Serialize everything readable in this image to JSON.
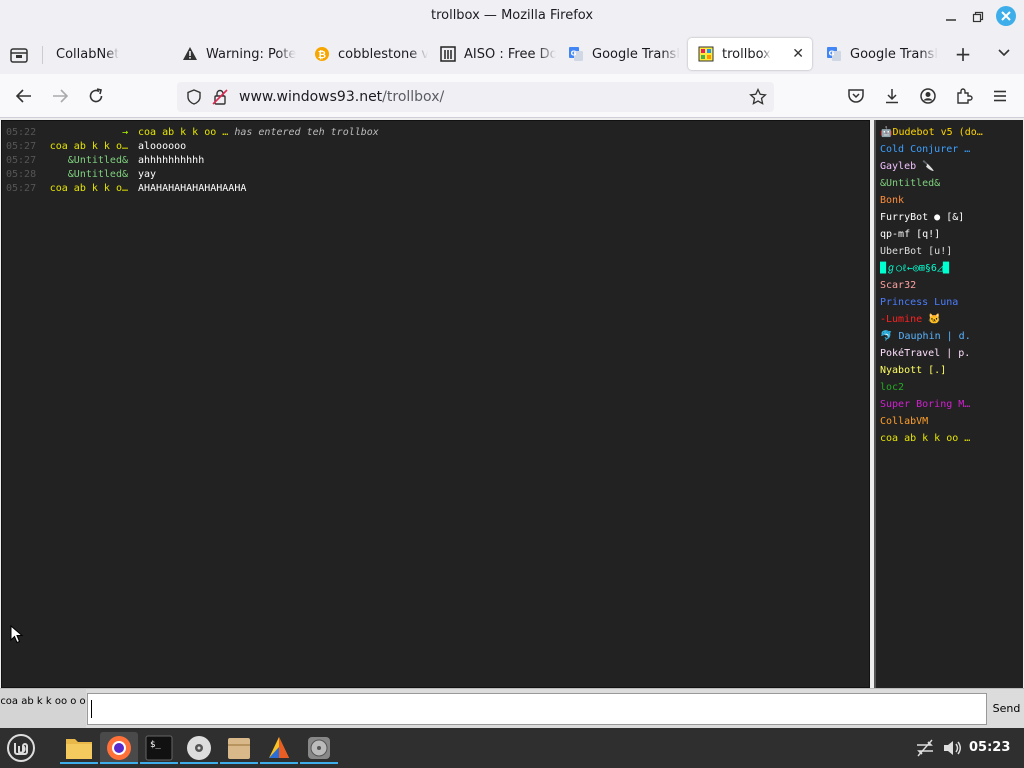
{
  "window": {
    "title": "trollbox — Mozilla Firefox"
  },
  "tabs": [
    {
      "label": "CollabNet",
      "favicon": "none"
    },
    {
      "label": "Warning: Pote",
      "favicon": "warning-icon"
    },
    {
      "label": "cobblestone v",
      "favicon": "bitcoin-icon"
    },
    {
      "label": "AISO : Free Do",
      "favicon": "archive-icon"
    },
    {
      "label": "Google Transl",
      "favicon": "google-translate-icon"
    },
    {
      "label": "trollbox",
      "favicon": "trollbox-icon",
      "active": true
    },
    {
      "label": "Google Transl",
      "favicon": "google-translate-icon"
    }
  ],
  "navbar": {
    "url_host": "www.windows93.net",
    "url_path": "/trollbox/"
  },
  "chat": {
    "messages": [
      {
        "time": "05:22",
        "nick": "→",
        "nick_color": "#b4ff00",
        "text": "coa ab k k oo … has entered teh trollbox",
        "join_nick": "coa ab k k oo …",
        "join_text": " has entered teh trollbox",
        "system": true
      },
      {
        "time": "05:27",
        "nick": "coa ab k k o…",
        "nick_color": "#e6e600",
        "text": "aloooooo"
      },
      {
        "time": "05:27",
        "nick": "&Untitled&",
        "nick_color": "#7fd17f",
        "text": "ahhhhhhhhhh"
      },
      {
        "time": "05:28",
        "nick": "&Untitled&",
        "nick_color": "#7fd17f",
        "text": "yay"
      },
      {
        "time": "05:27",
        "nick": "coa ab k k o…",
        "nick_color": "#e6e600",
        "text": "AHAHAHAHAHAHAHAAHA"
      }
    ]
  },
  "users": [
    {
      "name": "🤖Dudebot v5 (do…",
      "color": "#ffd700"
    },
    {
      "name": "Cold Conjurer …",
      "color": "#3aa0ff"
    },
    {
      "name": "Gayleb 🔪",
      "color": "#f0c0ff"
    },
    {
      "name": "&Untitled&",
      "color": "#7fd17f"
    },
    {
      "name": "Bonk",
      "color": "#ff8c3a"
    },
    {
      "name": "FurryBot ● [&]",
      "color": "#ffffff"
    },
    {
      "name": "qp-mf [q!]",
      "color": "#ffffff"
    },
    {
      "name": "UberBot [u!]",
      "color": "#dddddd"
    },
    {
      "name": "█ℊ○ℓ←◎⊞§6◿█",
      "color": "#00ffd0"
    },
    {
      "name": "Scar32",
      "color": "#ffa0a0"
    },
    {
      "name": "Princess Luna",
      "color": "#4a7dff"
    },
    {
      "name": "-Lumine 🐱",
      "color": "#ff2020"
    },
    {
      "name": "🐬 Dauphin | d.",
      "color": "#5ab4ff"
    },
    {
      "name": "PokéTravel | p.",
      "color": "#ffe0ff"
    },
    {
      "name": "Nyabott [.]",
      "color": "#ffff60"
    },
    {
      "name": "loc2",
      "color": "#22aa22"
    },
    {
      "name": "Super Boring M…",
      "color": "#d020d0"
    },
    {
      "name": "CollabVM",
      "color": "#ff9f2a"
    },
    {
      "name": "coa ab k k oo …",
      "color": "#e6e600"
    }
  ],
  "input": {
    "self_nick": "coa ab k k oo o o",
    "send_label": "Send",
    "value": ""
  },
  "taskbar": {
    "clock": "05:23"
  }
}
